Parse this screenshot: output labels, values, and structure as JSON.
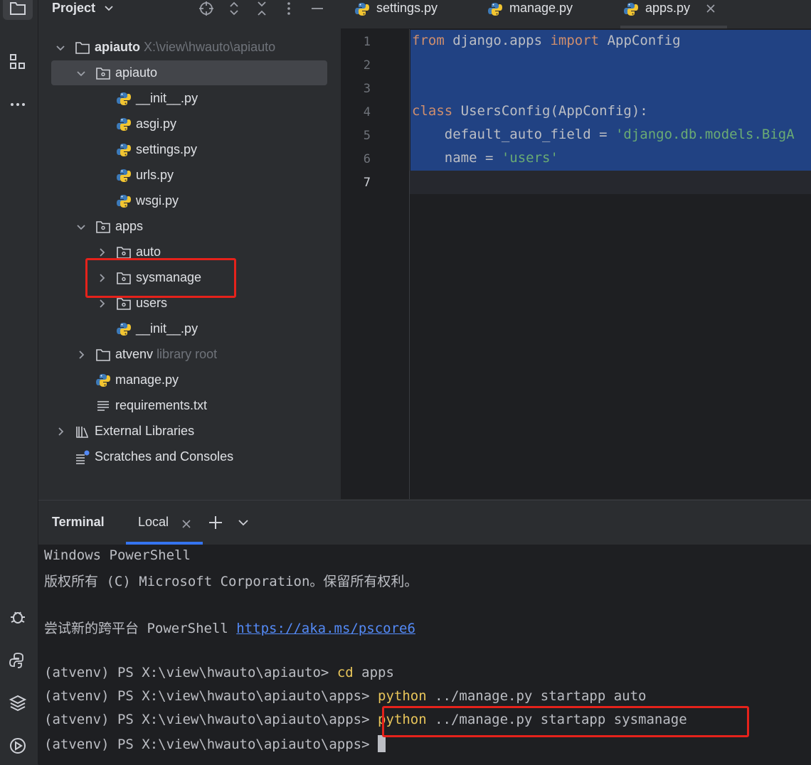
{
  "toolstrip": {
    "items": [
      "folder-icon",
      "structure-icon",
      "more-icon",
      "debug-icon",
      "python-console-icon",
      "layers-icon",
      "services-icon"
    ]
  },
  "project": {
    "title": "Project",
    "tree": [
      {
        "label": "apiauto",
        "hint": "X:\\view\\hwauto\\apiauto",
        "type": "folder",
        "expanded": true,
        "depth": 0,
        "bold": true
      },
      {
        "label": "apiauto",
        "type": "package",
        "expanded": true,
        "depth": 1,
        "selected": true
      },
      {
        "label": "__init__.py",
        "type": "python",
        "depth": 2
      },
      {
        "label": "asgi.py",
        "type": "python",
        "depth": 2
      },
      {
        "label": "settings.py",
        "type": "python",
        "depth": 2
      },
      {
        "label": "urls.py",
        "type": "python",
        "depth": 2
      },
      {
        "label": "wsgi.py",
        "type": "python",
        "depth": 2
      },
      {
        "label": "apps",
        "type": "package",
        "expanded": true,
        "depth": 1
      },
      {
        "label": "auto",
        "type": "package",
        "expanded": false,
        "depth": 2
      },
      {
        "label": "sysmanage",
        "type": "package",
        "expanded": false,
        "depth": 2,
        "highlighted": true
      },
      {
        "label": "users",
        "type": "package",
        "expanded": false,
        "depth": 2
      },
      {
        "label": "__init__.py",
        "type": "python",
        "depth": 2
      },
      {
        "label": "atvenv",
        "hint": "library root",
        "type": "folder",
        "expanded": false,
        "depth": 1
      },
      {
        "label": "manage.py",
        "type": "python",
        "depth": 1
      },
      {
        "label": "requirements.txt",
        "type": "text",
        "depth": 1
      },
      {
        "label": "External Libraries",
        "type": "library",
        "expanded": false,
        "depth": 0
      },
      {
        "label": "Scratches and Consoles",
        "type": "scratch",
        "depth": 0
      }
    ]
  },
  "editor": {
    "tabs": [
      {
        "label": "settings.py",
        "active": false
      },
      {
        "label": "manage.py",
        "active": false
      },
      {
        "label": "apps.py",
        "active": true,
        "closable": true
      }
    ],
    "line_numbers": [
      "1",
      "2",
      "3",
      "4",
      "5",
      "6",
      "7"
    ],
    "lines": [
      [
        {
          "t": "from",
          "c": "kw"
        },
        {
          "t": " django.apps ",
          "c": ""
        },
        {
          "t": "import",
          "c": "kw"
        },
        {
          "t": " AppConfig",
          "c": ""
        }
      ],
      [],
      [],
      [
        {
          "t": "class",
          "c": "kw"
        },
        {
          "t": " UsersConfig(AppConfig):",
          "c": ""
        }
      ],
      [
        {
          "t": "    default_auto_field = ",
          "c": ""
        },
        {
          "t": "'django.db.models.BigA",
          "c": "str"
        }
      ],
      [
        {
          "t": "    name = ",
          "c": ""
        },
        {
          "t": "'users'",
          "c": "str"
        }
      ],
      []
    ]
  },
  "terminal": {
    "title": "Terminal",
    "tab_label": "Local",
    "lines": [
      [
        {
          "t": "Windows PowerShell",
          "c": ""
        }
      ],
      [
        {
          "t": "版权所有 (C) Microsoft Corporation。保留所有权利。",
          "c": ""
        }
      ],
      [],
      [
        {
          "t": "尝试新的跨平台 PowerShell ",
          "c": ""
        },
        {
          "t": "https://aka.ms/pscore6",
          "c": "link"
        }
      ],
      [],
      [
        {
          "t": "(atvenv) PS X:\\view\\hwauto\\apiauto> ",
          "c": ""
        },
        {
          "t": "cd",
          "c": "yel"
        },
        {
          "t": " apps",
          "c": ""
        }
      ],
      [
        {
          "t": "(atvenv) PS X:\\view\\hwauto\\apiauto\\apps> ",
          "c": ""
        },
        {
          "t": "python",
          "c": "yel"
        },
        {
          "t": " ../manage.py startapp auto",
          "c": ""
        }
      ],
      [
        {
          "t": "(atvenv) PS X:\\view\\hwauto\\apiauto\\apps> ",
          "c": ""
        },
        {
          "t": "python",
          "c": "yel"
        },
        {
          "t": " ../manage.py startapp sysmanage",
          "c": ""
        }
      ],
      [
        {
          "t": "(atvenv) PS X:\\view\\hwauto\\apiauto\\apps> ",
          "c": ""
        }
      ]
    ]
  },
  "colors": {
    "annotation_red": "#e5221b",
    "selection": "#214283",
    "keyword": "#cf8e6d",
    "string": "#6aab73",
    "command": "#e8c55a"
  }
}
